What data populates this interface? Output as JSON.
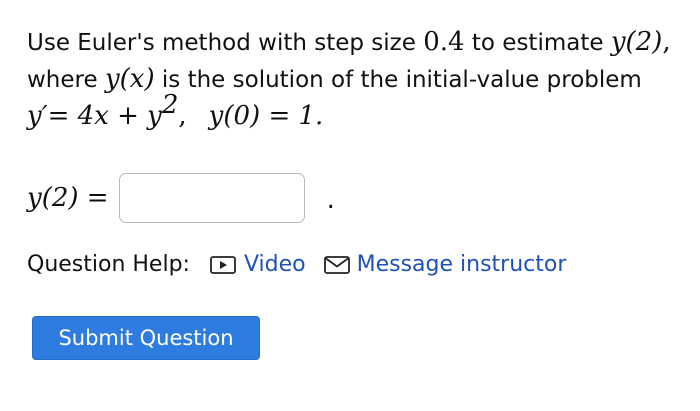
{
  "question": {
    "line1_text_a": "Use Euler's method with step size ",
    "step_size": "0.4",
    "line1_text_b": " to estimate ",
    "target": "y(2)",
    "line1_punct": ",",
    "line2_text_a": "where ",
    "function_expr": "y(x)",
    "line2_text_b": " is the solution of the initial-value problem",
    "ode": "y′= 4x + y",
    "ode_exponent": "2",
    "ode_sep": ",",
    "initial_condition": "y(0) = 1."
  },
  "answer": {
    "label": "y(2) =",
    "value": "",
    "trailing": "."
  },
  "help": {
    "label": "Question Help:",
    "video_label": "Video",
    "message_label": "Message instructor"
  },
  "submit": {
    "label": "Submit Question"
  },
  "colors": {
    "link": "#1e52b8",
    "button": "#2f7ce0"
  },
  "icons": {
    "video": "video-play-icon",
    "message": "mail-envelope-icon"
  }
}
